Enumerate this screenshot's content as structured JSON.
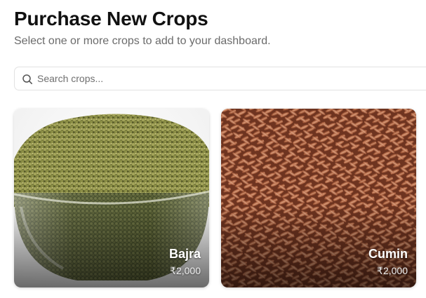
{
  "header": {
    "title": "Purchase New Crops",
    "subtitle": "Select one or more crops to add to your dashboard."
  },
  "search": {
    "placeholder": "Search crops...",
    "value": "",
    "icon": "search-icon"
  },
  "crops": [
    {
      "name": "Bajra",
      "price": "₹2,000",
      "image": "green millet grains in a glass bowl"
    },
    {
      "name": "Cumin",
      "price": "₹2,000",
      "image": "brown cumin seeds"
    }
  ],
  "colors": {
    "title": "#111111",
    "subtitle": "#6b6b6b",
    "border": "#e2e2e2",
    "bajra_grain": "#7c7f3a",
    "cumin_seed": "#9a5535"
  }
}
